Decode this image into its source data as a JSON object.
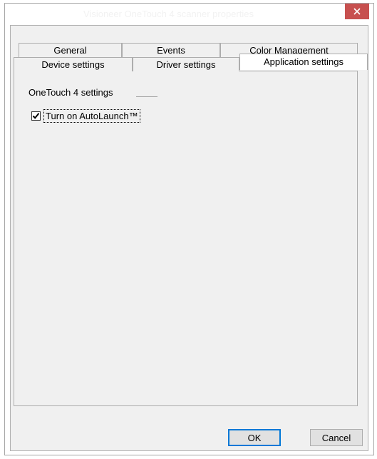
{
  "window": {
    "title": "Visioneer OneTouch 4 scanner properties",
    "close_glyph": "✕"
  },
  "tabs": {
    "back_row": [
      {
        "label": "General"
      },
      {
        "label": "Events"
      },
      {
        "label": "Color Management"
      }
    ],
    "front_row": [
      {
        "label": "Device settings"
      },
      {
        "label": "Driver settings"
      },
      {
        "label": "Application settings",
        "active": true
      }
    ]
  },
  "panel": {
    "group_label": "OneTouch 4 settings",
    "autolaunch": {
      "label": "Turn on AutoLaunch™",
      "checked": true
    }
  },
  "buttons": {
    "ok_label": "OK",
    "cancel_label": "Cancel"
  },
  "colors": {
    "close_button": "#c7504f",
    "dialog_background": "#f0f0f0",
    "active_tab": "#ffffff",
    "default_button_border": "#0078d7"
  }
}
